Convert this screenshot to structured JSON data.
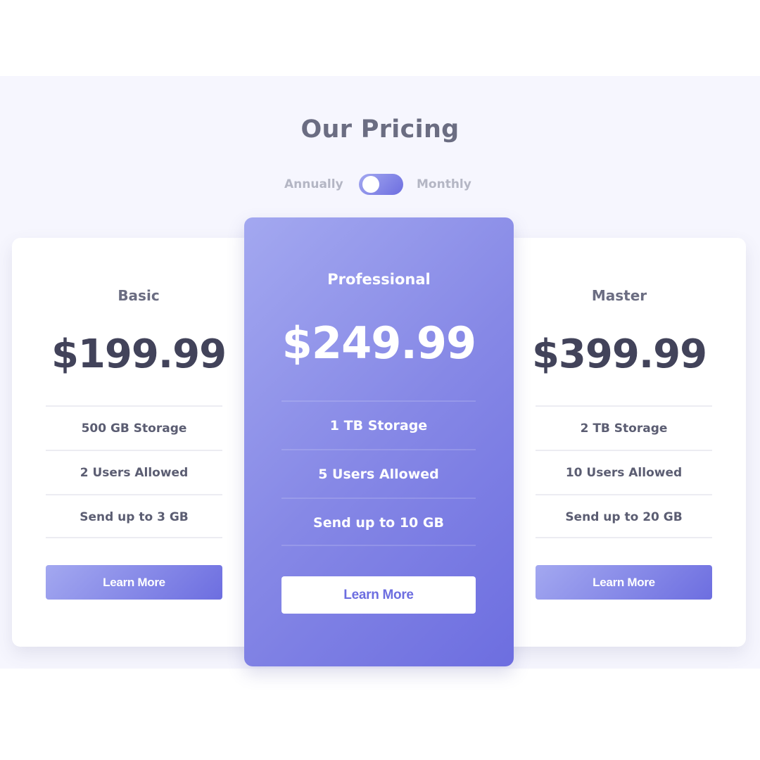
{
  "header": {
    "title": "Our Pricing"
  },
  "billing_toggle": {
    "left_label": "Annually",
    "right_label": "Monthly",
    "selected": "Annually"
  },
  "colors": {
    "accent_start": "#a3a8f0",
    "accent_end": "#6d6ee0",
    "heading": "#6b6d82",
    "price_text": "#42435a",
    "section_bg": "#f6f6fe"
  },
  "plans": [
    {
      "name": "Basic",
      "price": "$199.99",
      "features": [
        "500 GB Storage",
        "2 Users Allowed",
        "Send up to 3 GB"
      ],
      "button_label": "Learn More",
      "featured": false
    },
    {
      "name": "Professional",
      "price": "$249.99",
      "features": [
        "1 TB Storage",
        "5 Users Allowed",
        "Send up to 10 GB"
      ],
      "button_label": "Learn More",
      "featured": true
    },
    {
      "name": "Master",
      "price": "$399.99",
      "features": [
        "2 TB Storage",
        "10 Users Allowed",
        "Send up to 20 GB"
      ],
      "button_label": "Learn More",
      "featured": false
    }
  ]
}
